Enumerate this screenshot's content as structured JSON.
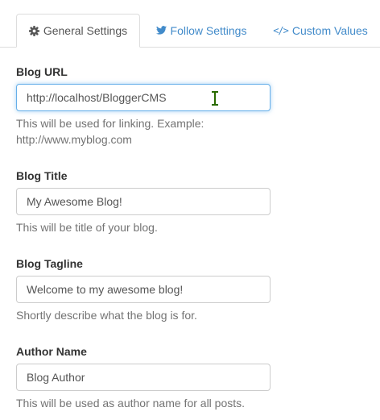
{
  "tabs": [
    {
      "label": "General Settings",
      "icon": "gear-icon",
      "active": true
    },
    {
      "label": "Follow Settings",
      "icon": "twitter-icon",
      "active": false
    },
    {
      "label": "Custom Values",
      "icon": "code-icon",
      "icon_glyph": "</>",
      "active": false
    }
  ],
  "fields": [
    {
      "label": "Blog URL",
      "value": "http://localhost/BloggerCMS",
      "help": "This will be used for linking. Example: http://www.myblog.com"
    },
    {
      "label": "Blog Title",
      "value": "My Awesome Blog!",
      "help": "This will be title of your blog."
    },
    {
      "label": "Blog Tagline",
      "value": "Welcome to my awesome blog!",
      "help": "Shortly describe what the blog is for."
    },
    {
      "label": "Author Name",
      "value": "Blog Author",
      "help": "This will be used as author name for all posts."
    }
  ],
  "colors": {
    "link": "#428bca",
    "border": "#dddddd",
    "input_border": "#cccccc",
    "focus": "#66afe9",
    "help_text": "#737373",
    "label_text": "#333333"
  }
}
